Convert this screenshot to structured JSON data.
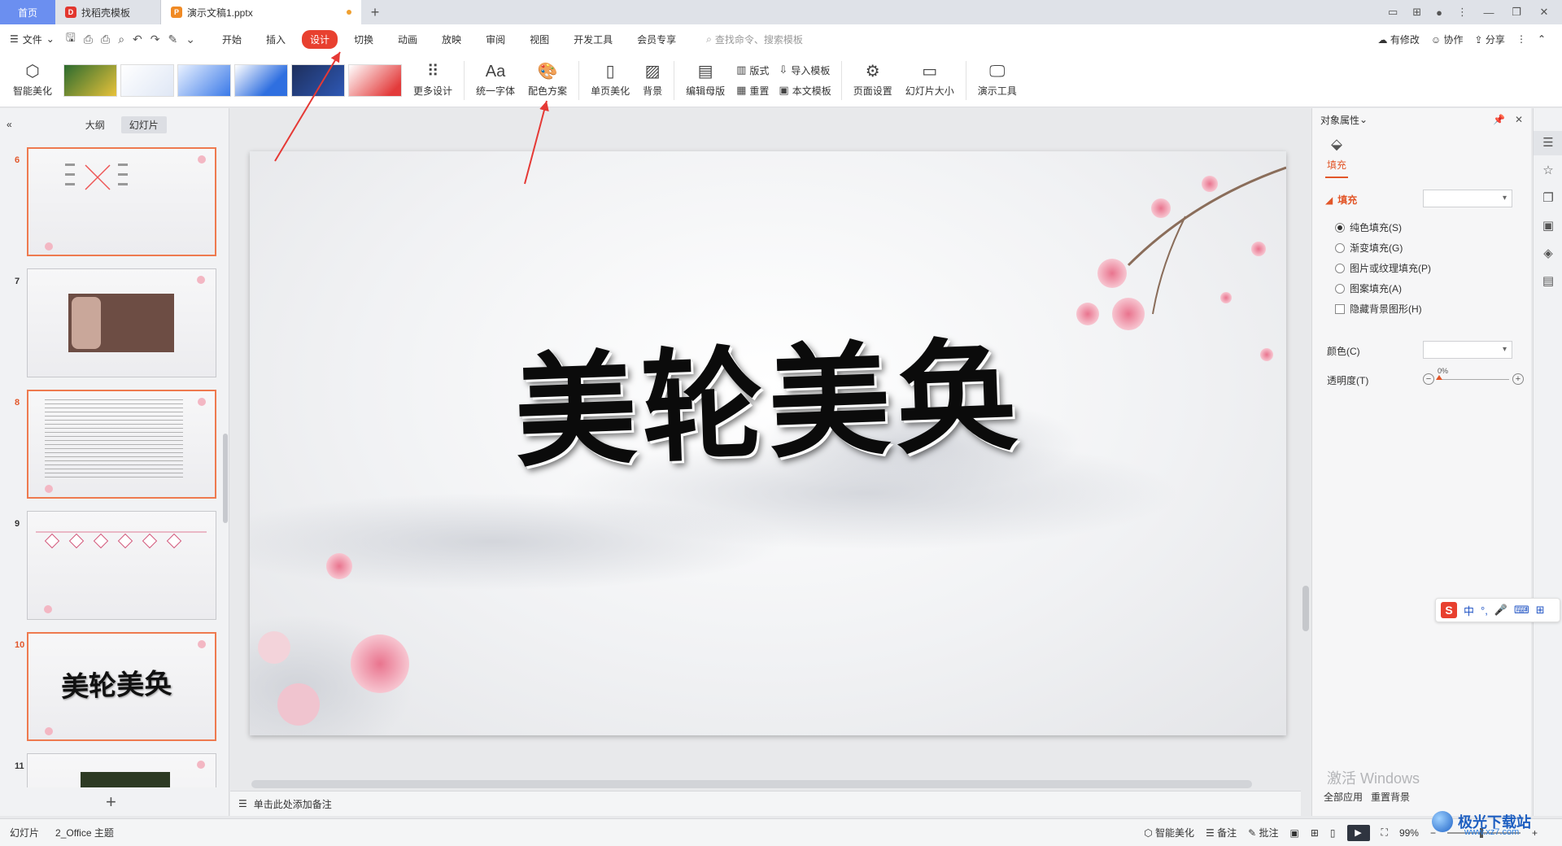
{
  "titlebar": {
    "tabs": [
      {
        "label": "首页"
      },
      {
        "label": "找稻壳模板"
      },
      {
        "label": "演示文稿1.pptx"
      }
    ],
    "new_tab": "+"
  },
  "menubar": {
    "file": "文件",
    "tabs": [
      "开始",
      "插入",
      "设计",
      "切换",
      "动画",
      "放映",
      "审阅",
      "视图",
      "开发工具",
      "会员专享"
    ],
    "active_tab": "设计",
    "search_placeholder": "查找命令、搜索模板",
    "right": {
      "modified": "有修改",
      "collab": "协作",
      "share": "分享"
    }
  },
  "ribbon": {
    "smart_beautify": "智能美化",
    "more_design": "更多设计",
    "unify_font": "统一字体",
    "color_scheme": "配色方案",
    "single_page_beautify": "单页美化",
    "background": "背景",
    "edit_master": "编辑母版",
    "layout": "版式",
    "reset": "重置",
    "import_template": "导入模板",
    "text_template": "本文模板",
    "page_setup": "页面设置",
    "slide_size": "幻灯片大小",
    "presentation_tools": "演示工具",
    "template_thumbs": [
      "thumb-1",
      "thumb-2",
      "thumb-3",
      "thumb-4",
      "thumb-5",
      "thumb-6"
    ]
  },
  "leftpanel": {
    "tabs": [
      "大纲",
      "幻灯片"
    ],
    "active_tab": "幻灯片",
    "slides": [
      {
        "num": "6",
        "selected": true
      },
      {
        "num": "7",
        "selected": false
      },
      {
        "num": "8",
        "selected": true
      },
      {
        "num": "9",
        "selected": false
      },
      {
        "num": "10",
        "selected": true,
        "title": "美轮美奂"
      },
      {
        "num": "11",
        "selected": false
      }
    ],
    "add": "+"
  },
  "slide": {
    "title": "美轮美奂"
  },
  "notes": {
    "placeholder": "单击此处添加备注"
  },
  "rightpanel": {
    "title": "对象属性",
    "fill_tab": "填充",
    "section": "填充",
    "options": [
      "纯色填充(S)",
      "渐变填充(G)",
      "图片或纹理填充(P)",
      "图案填充(A)"
    ],
    "selected_option": "纯色填充(S)",
    "hide_bg": "隐藏背景图形(H)",
    "color_label": "颜色(C)",
    "transparency_label": "透明度(T)",
    "transparency_value": "0%",
    "apply_all": "全部应用",
    "reset_bg": "重置背景",
    "activate_windows": "激活 Windows"
  },
  "ime": {
    "lang": "中"
  },
  "statusbar": {
    "slide": "幻灯片",
    "theme": "2_Office 主题",
    "smart_beautify": "智能美化",
    "notes": "备注",
    "comments": "批注",
    "zoom": "99%"
  },
  "watermark": {
    "title": "极光下载站",
    "url": "www.xz7.com"
  },
  "colors": {
    "accent": "#e8402f",
    "selection": "#ee7a4f",
    "home_tab": "#6b8ff0"
  }
}
